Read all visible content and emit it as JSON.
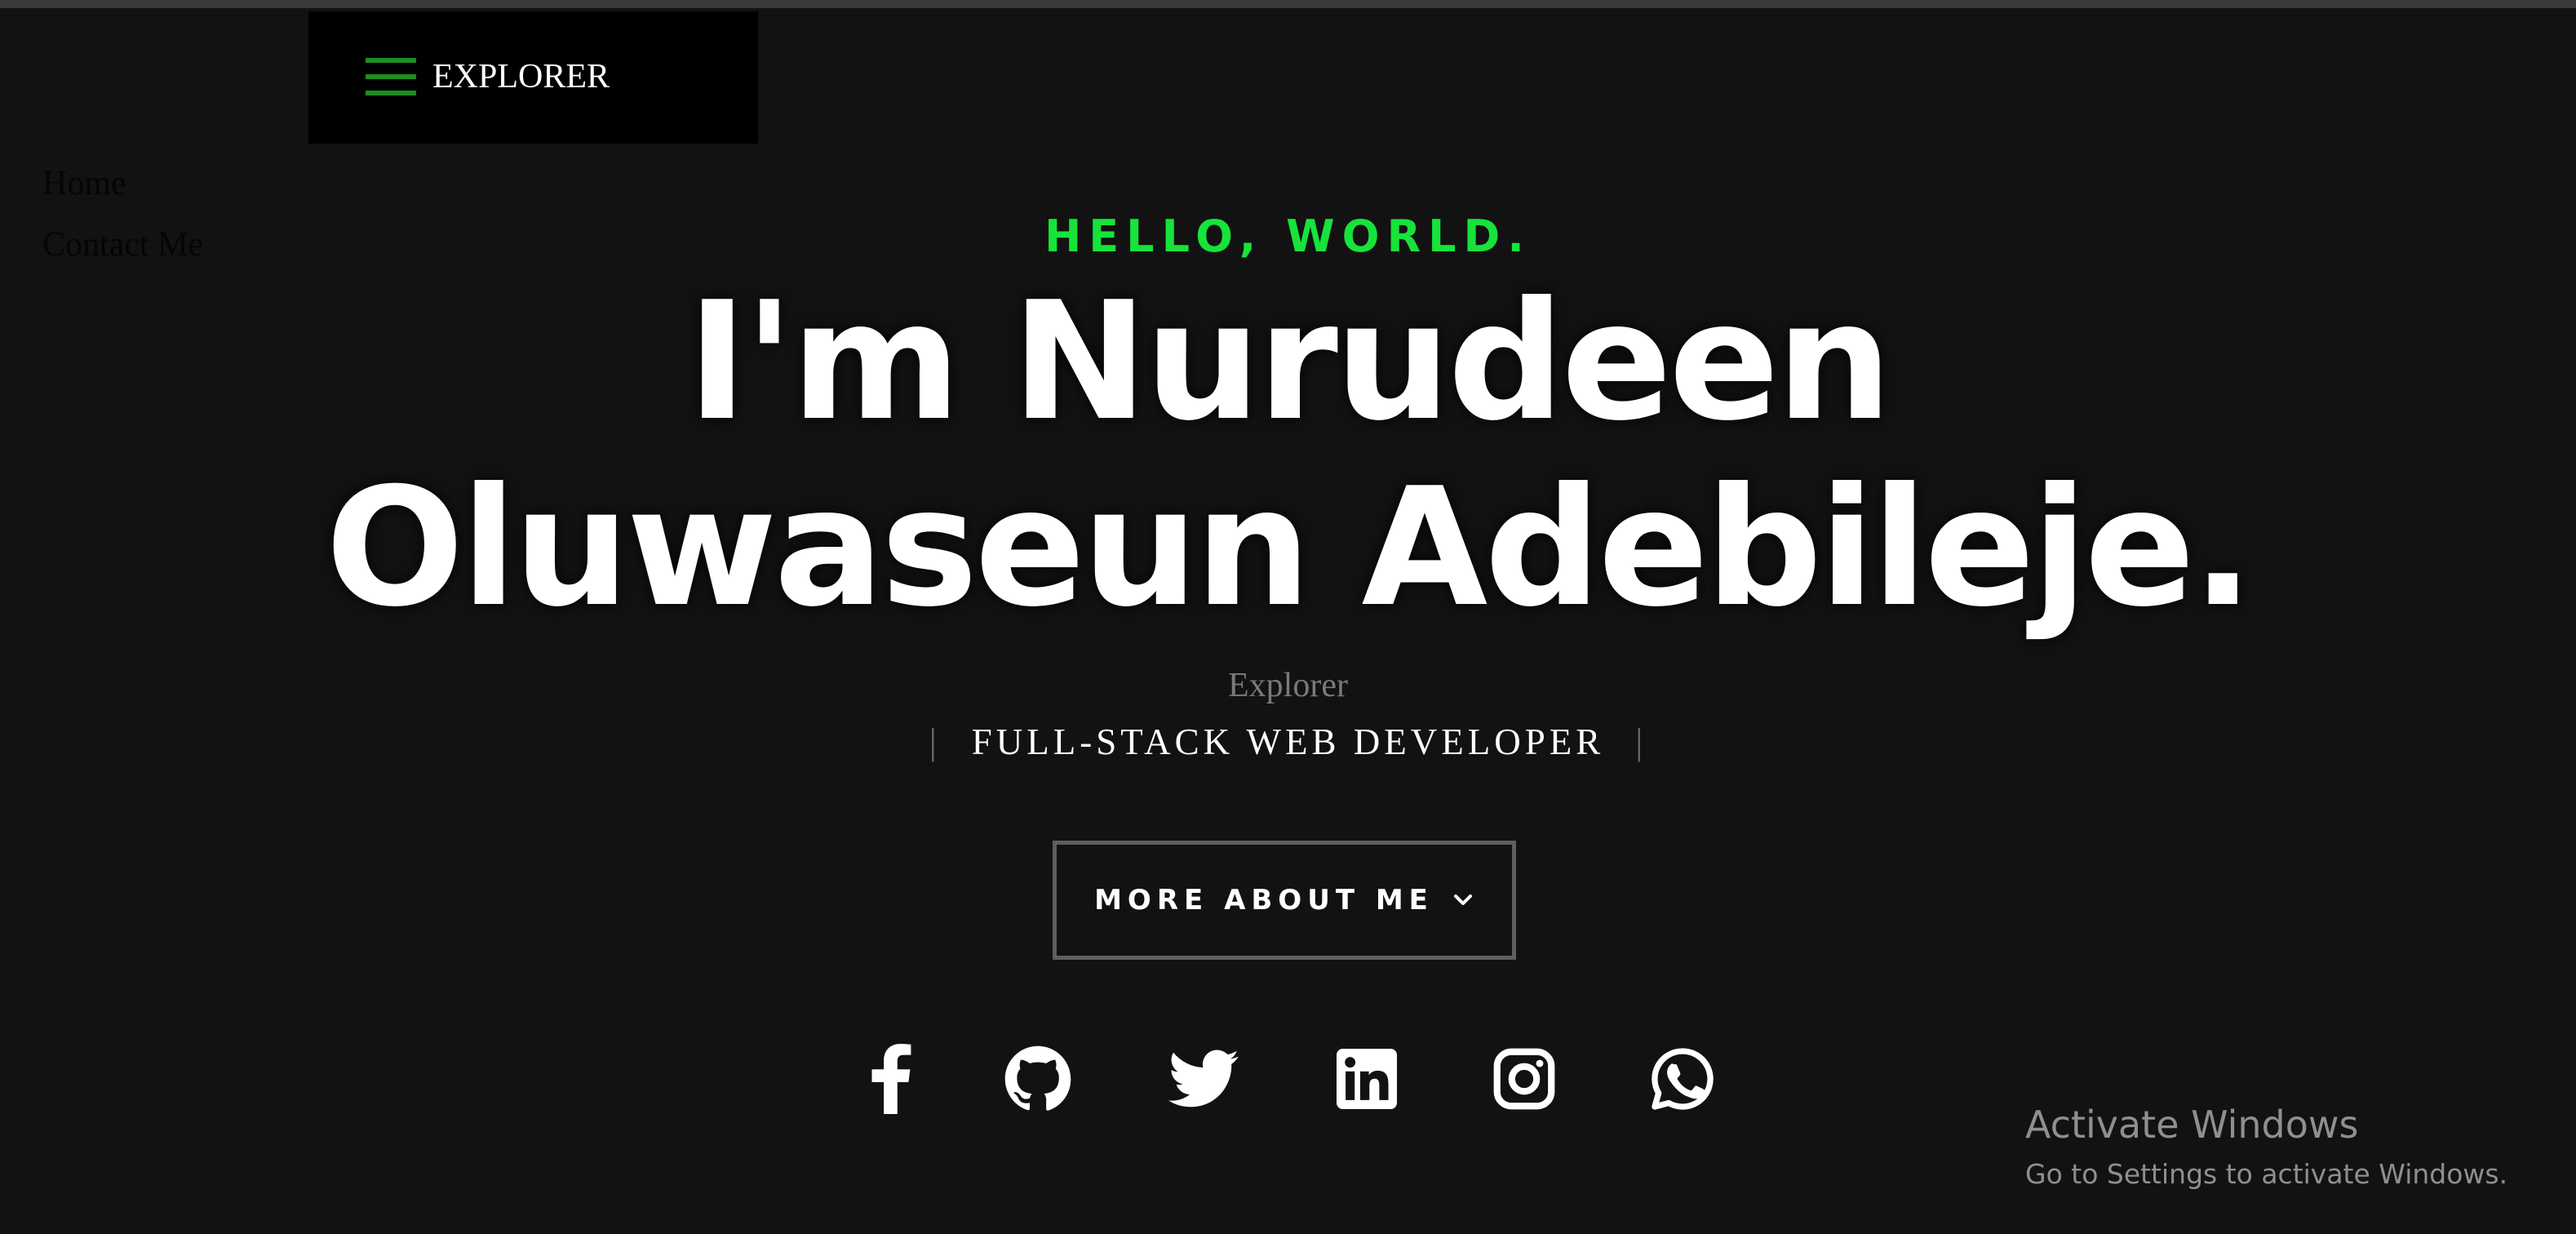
{
  "nav": {
    "brand": "EXPLORER",
    "menu_items": [
      "Home",
      "Contact Me"
    ]
  },
  "hero": {
    "greeting": "HELLO, WORLD.",
    "title_line1": "I'm Nurudeen",
    "title_line2": "Oluwaseun Adebileje.",
    "subtitle": "Explorer",
    "role": "FULL-STACK WEB DEVELOPER",
    "role_separator": "|",
    "cta_label": "MORE ABOUT ME"
  },
  "socials": [
    {
      "icon": "facebook-icon"
    },
    {
      "icon": "github-icon"
    },
    {
      "icon": "twitter-icon"
    },
    {
      "icon": "linkedin-icon"
    },
    {
      "icon": "instagram-icon"
    },
    {
      "icon": "whatsapp-icon"
    }
  ],
  "system_watermark": {
    "title": "Activate Windows",
    "subtitle": "Go to Settings to activate Windows."
  },
  "colors": {
    "background": "#121212",
    "accent_green": "#17e33a",
    "hamburger_green": "#1e8e1e",
    "nav_box": "#000000"
  }
}
